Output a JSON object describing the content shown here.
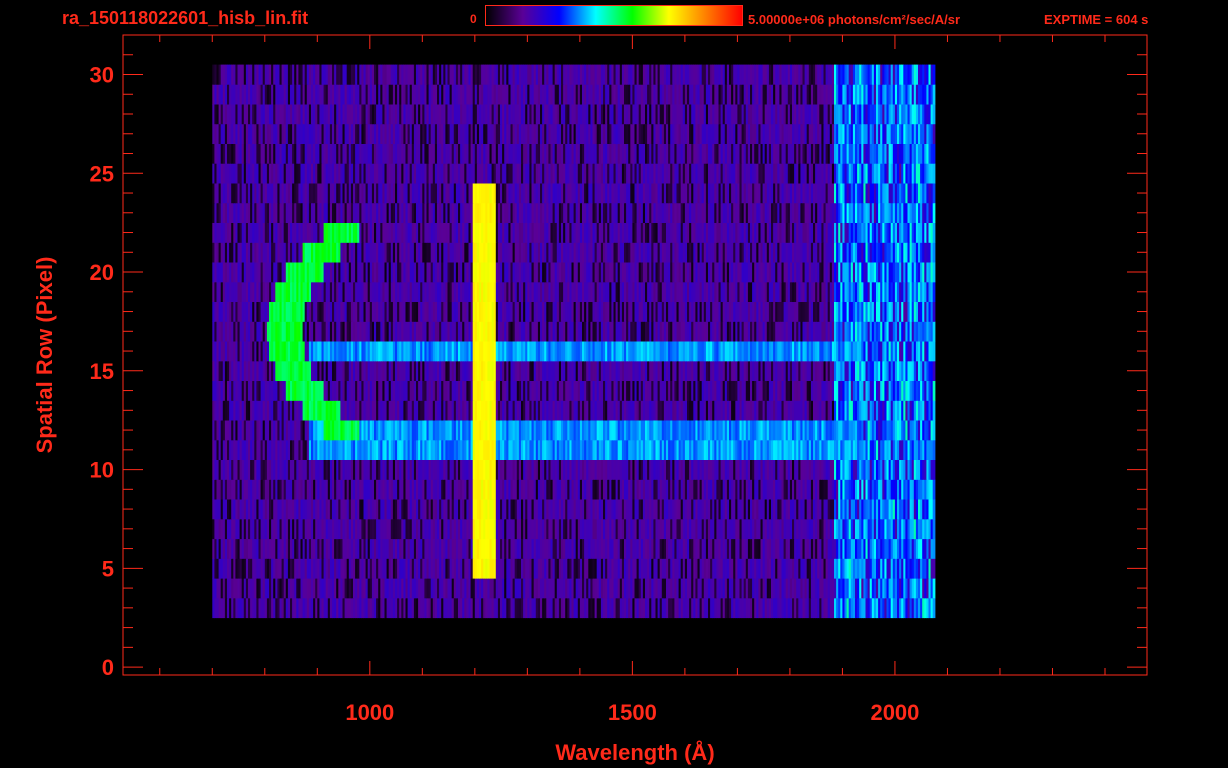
{
  "header": {
    "title": "ra_150118022601_hisb_lin.fit",
    "colorbar_min": "0",
    "colorbar_max": "5.00000e+06 photons/cm²/sec/A/sr",
    "exptime": "EXPTIME = 604 s"
  },
  "colors": {
    "text": "#ff2a1a",
    "background": "#000000",
    "colorbar_stops": [
      "#000000",
      "#5a0096",
      "#0000ff",
      "#00ffff",
      "#00ff00",
      "#ffff00",
      "#ff8000",
      "#ff0000"
    ]
  },
  "chart_data": {
    "type": "heatmap",
    "xlabel": "Wavelength (Å)",
    "ylabel": "Spatial Row (Pixel)",
    "xlim": [
      530,
      2480
    ],
    "ylim": [
      -0.4,
      32
    ],
    "xticks": [
      1000,
      1500,
      2000
    ],
    "yticks": [
      0,
      5,
      10,
      15,
      20,
      25,
      30
    ],
    "data_extent": {
      "x": [
        700,
        2075
      ],
      "y": [
        3,
        30
      ]
    },
    "scale": [
      0,
      5000000
    ],
    "features": [
      {
        "type": "emission_line",
        "x": 1216,
        "y_range": [
          5,
          24
        ],
        "peak_value": 0.7
      },
      {
        "type": "arc",
        "x_range": [
          800,
          915
        ],
        "y_range": [
          12,
          22
        ],
        "peak_value": 0.55
      },
      {
        "type": "continuum_band",
        "y_rows": [
          11,
          12,
          16
        ],
        "x_range": [
          880,
          2075
        ],
        "value": 0.32
      }
    ],
    "grid": false
  }
}
